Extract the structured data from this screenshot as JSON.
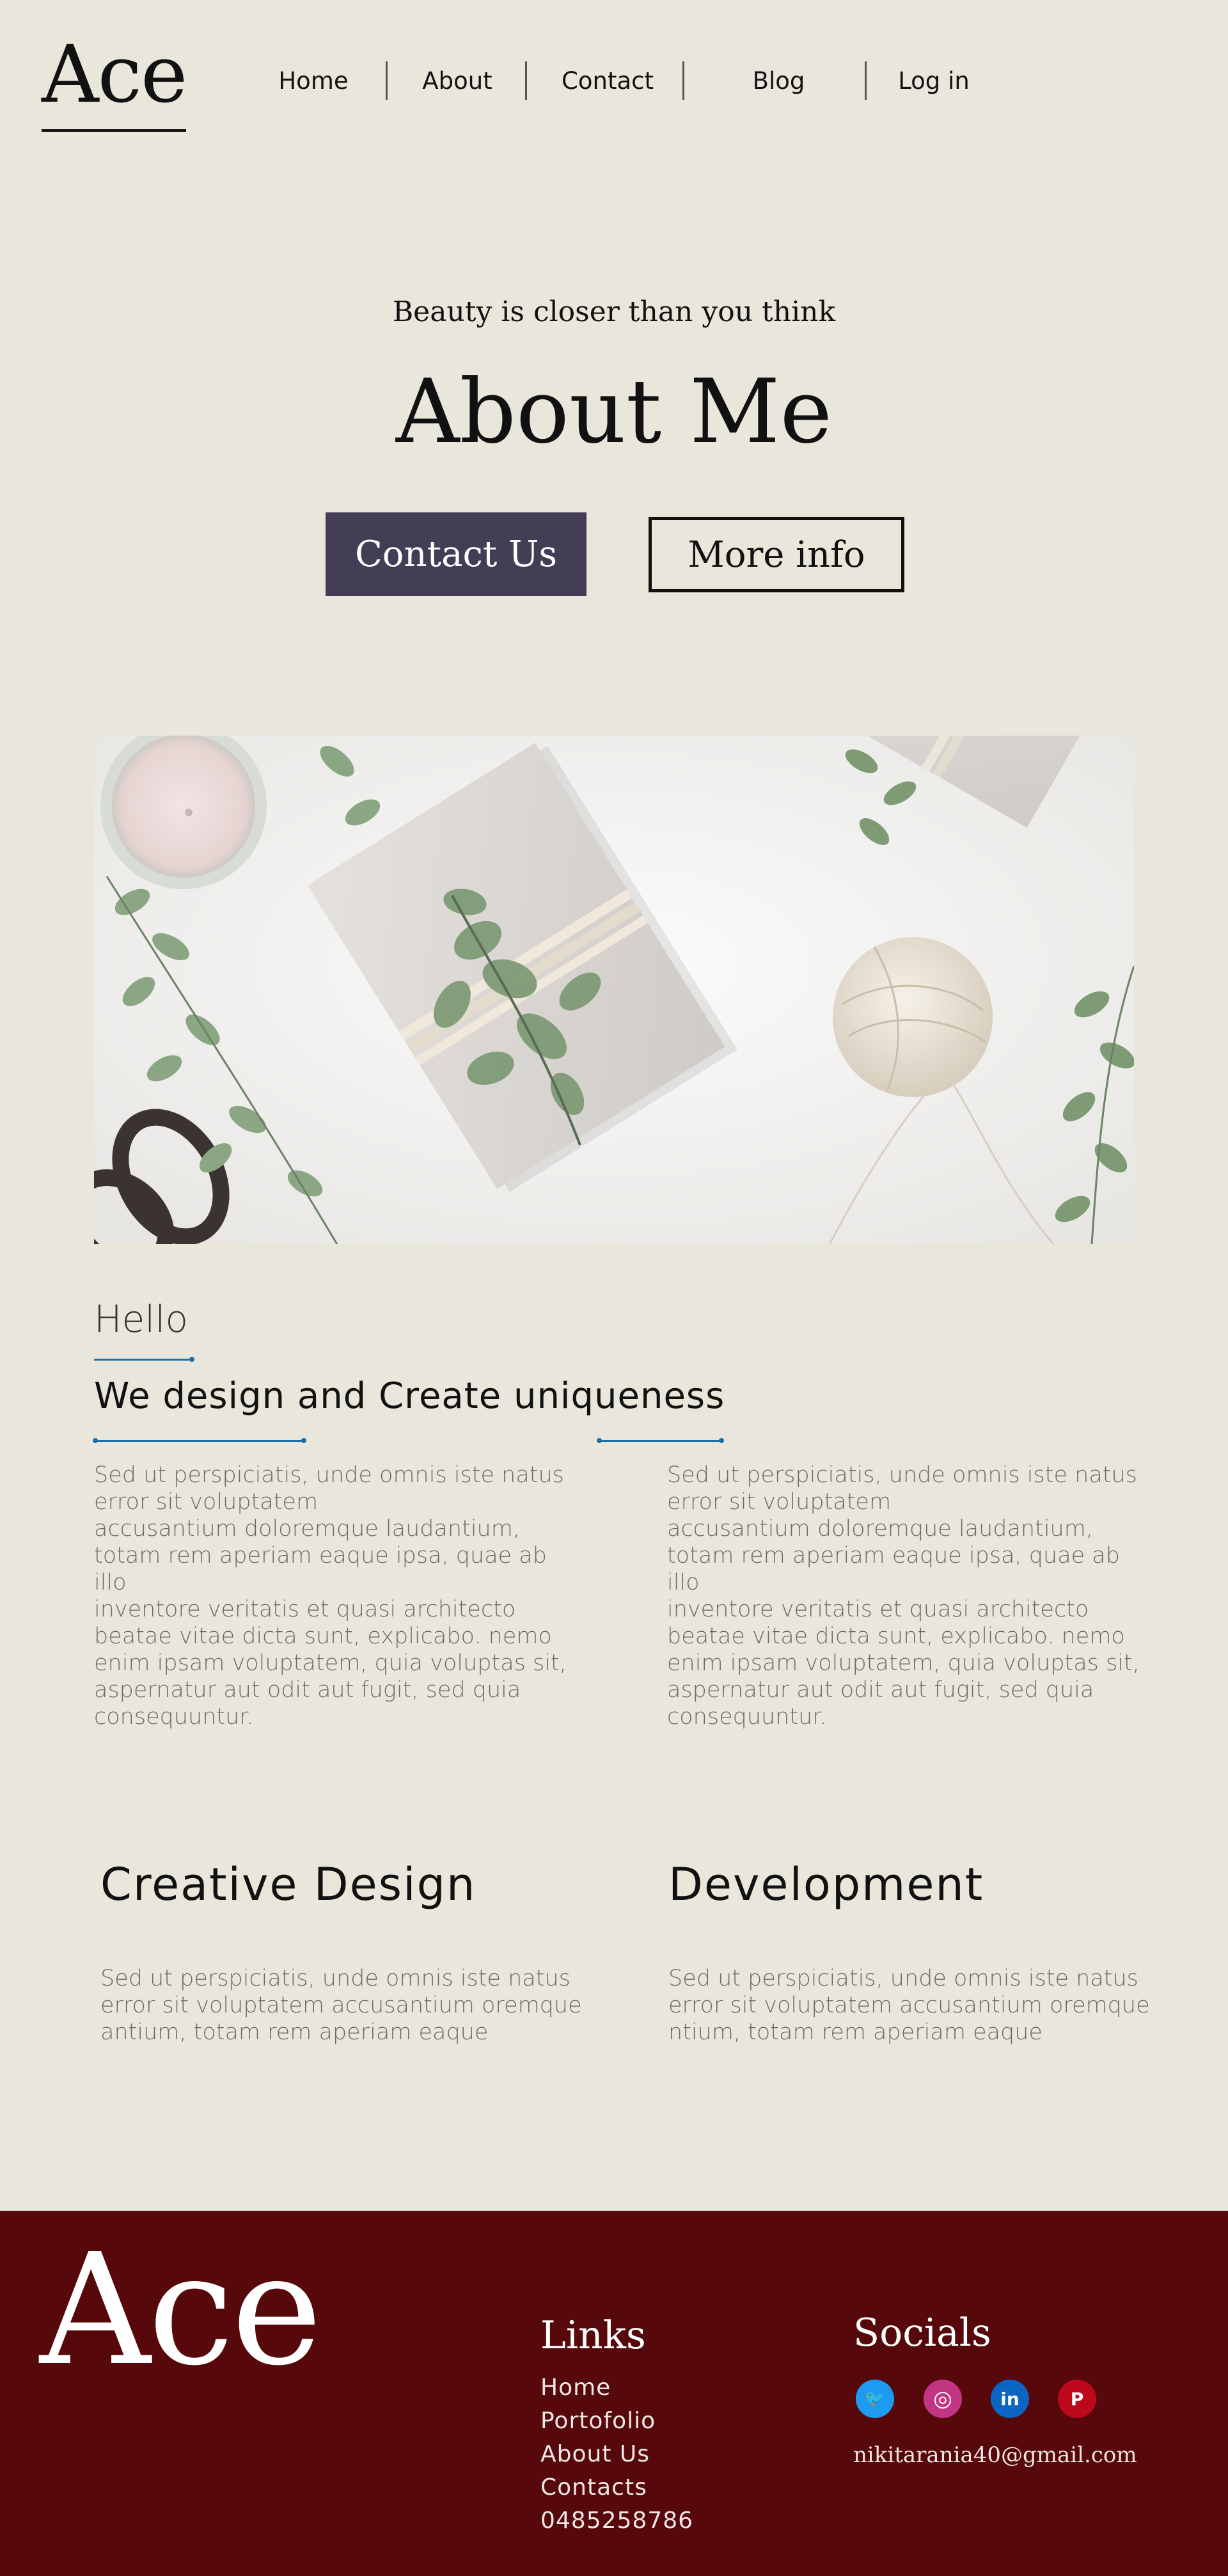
{
  "header": {
    "logo": "Ace",
    "nav": [
      "Home",
      "About",
      "Contact",
      "Blog",
      "Log in"
    ]
  },
  "hero": {
    "tagline": "Beauty is closer than you think",
    "title": "About Me",
    "primary_button": "Contact Us",
    "secondary_button": "More info"
  },
  "intro": {
    "hello": "Hello",
    "subtitle": "We design and Create uniqueness",
    "paragraph_left": "Sed ut perspiciatis, unde omnis iste natus\nerror sit voluptatem\n accusantium doloremque laudantium,\ntotam rem aperiam eaque ipsa, quae ab illo\ninventore veritatis et quasi architecto\nbeatae vitae dicta sunt, explicabo. nemo\nenim ipsam voluptatem, quia voluptas sit,\naspernatur aut odit aut fugit, sed quia\nconsequuntur.",
    "paragraph_right": "Sed ut perspiciatis, unde omnis iste natus\nerror sit voluptatem\n accusantium doloremque laudantium,\ntotam rem aperiam eaque ipsa, quae ab illo\ninventore veritatis et quasi architecto\nbeatae vitae dicta sunt, explicabo. nemo\nenim ipsam voluptatem, quia voluptas sit,\naspernatur aut odit aut fugit, sed quia\nconsequuntur."
  },
  "services": [
    {
      "title": "Creative Design",
      "text": "Sed ut perspiciatis, unde omnis iste natus error sit voluptatem  accusantium oremque antium, totam rem aperiam eaque"
    },
    {
      "title": "Development",
      "text": "Sed ut perspiciatis, unde omnis iste natus error sit voluptatem  accusantium oremque ntium, totam rem aperiam eaque"
    }
  ],
  "footer": {
    "logo": "Ace",
    "links_heading": "Links",
    "links": [
      "Home",
      "Portofolio",
      "About Us",
      "Contacts",
      "0485258786"
    ],
    "socials_heading": "Socials",
    "socials": [
      {
        "icon": "twitter-icon",
        "glyph": "🐦",
        "color": "#1d9bf0"
      },
      {
        "icon": "instagram-icon",
        "glyph": "◎",
        "color": "#c13584"
      },
      {
        "icon": "linkedin-icon",
        "glyph": "in",
        "color": "#0a66c2"
      },
      {
        "icon": "pinterest-icon",
        "glyph": "P",
        "color": "#bd081c"
      }
    ],
    "email": "nikitarania40@gmail.com"
  },
  "colors": {
    "background": "#e9e6dc",
    "primary_button": "#433e56",
    "accent_line": "#1e6fa8",
    "footer": "#56080a"
  }
}
